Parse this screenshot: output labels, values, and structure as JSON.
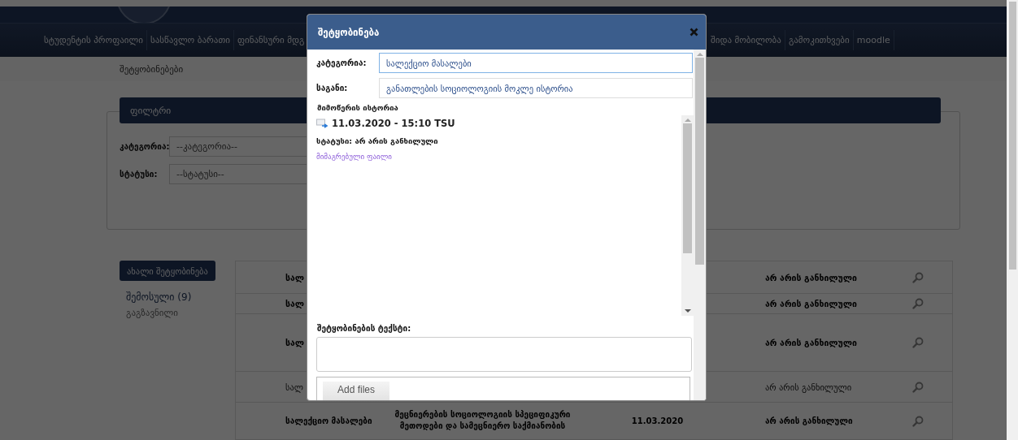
{
  "header": {
    "nav": [
      "სტუდენტის პროფაილი",
      "სასწავლო ბარათი",
      "ფინანსური მდგ",
      "შიდა მობილობა",
      "გამოკითხვები",
      "moodle"
    ]
  },
  "breadcrumb": "შეტყობინებები",
  "filter": {
    "title": "ფილტრი",
    "fields": [
      {
        "label": "კატეგორია:",
        "value": "--კატეგორია--"
      },
      {
        "label": "სტატუსი:",
        "value": "--სტატუსი--"
      }
    ]
  },
  "sidebar": {
    "new_button": "ახალი შეტყობინება",
    "folders": [
      {
        "label": "შემოსული (9)",
        "selected": true
      },
      {
        "label": "გაგზავნილი",
        "selected": false
      }
    ]
  },
  "table": {
    "rows": [
      {
        "category": "სალ",
        "status": "არ არის განხილული",
        "unread": true
      },
      {
        "category": "სალ",
        "status": "არ არის განხილული",
        "unread": true
      },
      {
        "category": "სალ",
        "status": "არ არის განხილული",
        "unread": true
      },
      {
        "category": "სალ",
        "status": "არ არის განხილული",
        "unread": false
      },
      {
        "category": "სალექციო მასალები",
        "subject": "მეცნიერების სოციოლოგიის სპეციფიკური მეთოდები და სამეცნიერო საქმიანობის",
        "date": "11.03.2020",
        "status": "არ არის განხილული",
        "unread": true
      }
    ]
  },
  "modal": {
    "title": "შეტყობინება",
    "fields": [
      {
        "label": "კატეგორია:",
        "value": "სალექციო მასალები",
        "focused": true
      },
      {
        "label": "საგანი:",
        "value": "განათლების სოციოლოგიის მოკლე ისტორია",
        "focused": false
      }
    ],
    "history": {
      "title": "მიმოწერის ისტორია",
      "entries": [
        {
          "header": "11.03.2020 - 15:10 TSU",
          "status": "სტატუსი: არ არის განხილული",
          "attachment": "მიმაგრებული ფაილი"
        }
      ]
    },
    "message_label": "შეტყობინების ტექსტი:",
    "upload_button": "Add files"
  }
}
